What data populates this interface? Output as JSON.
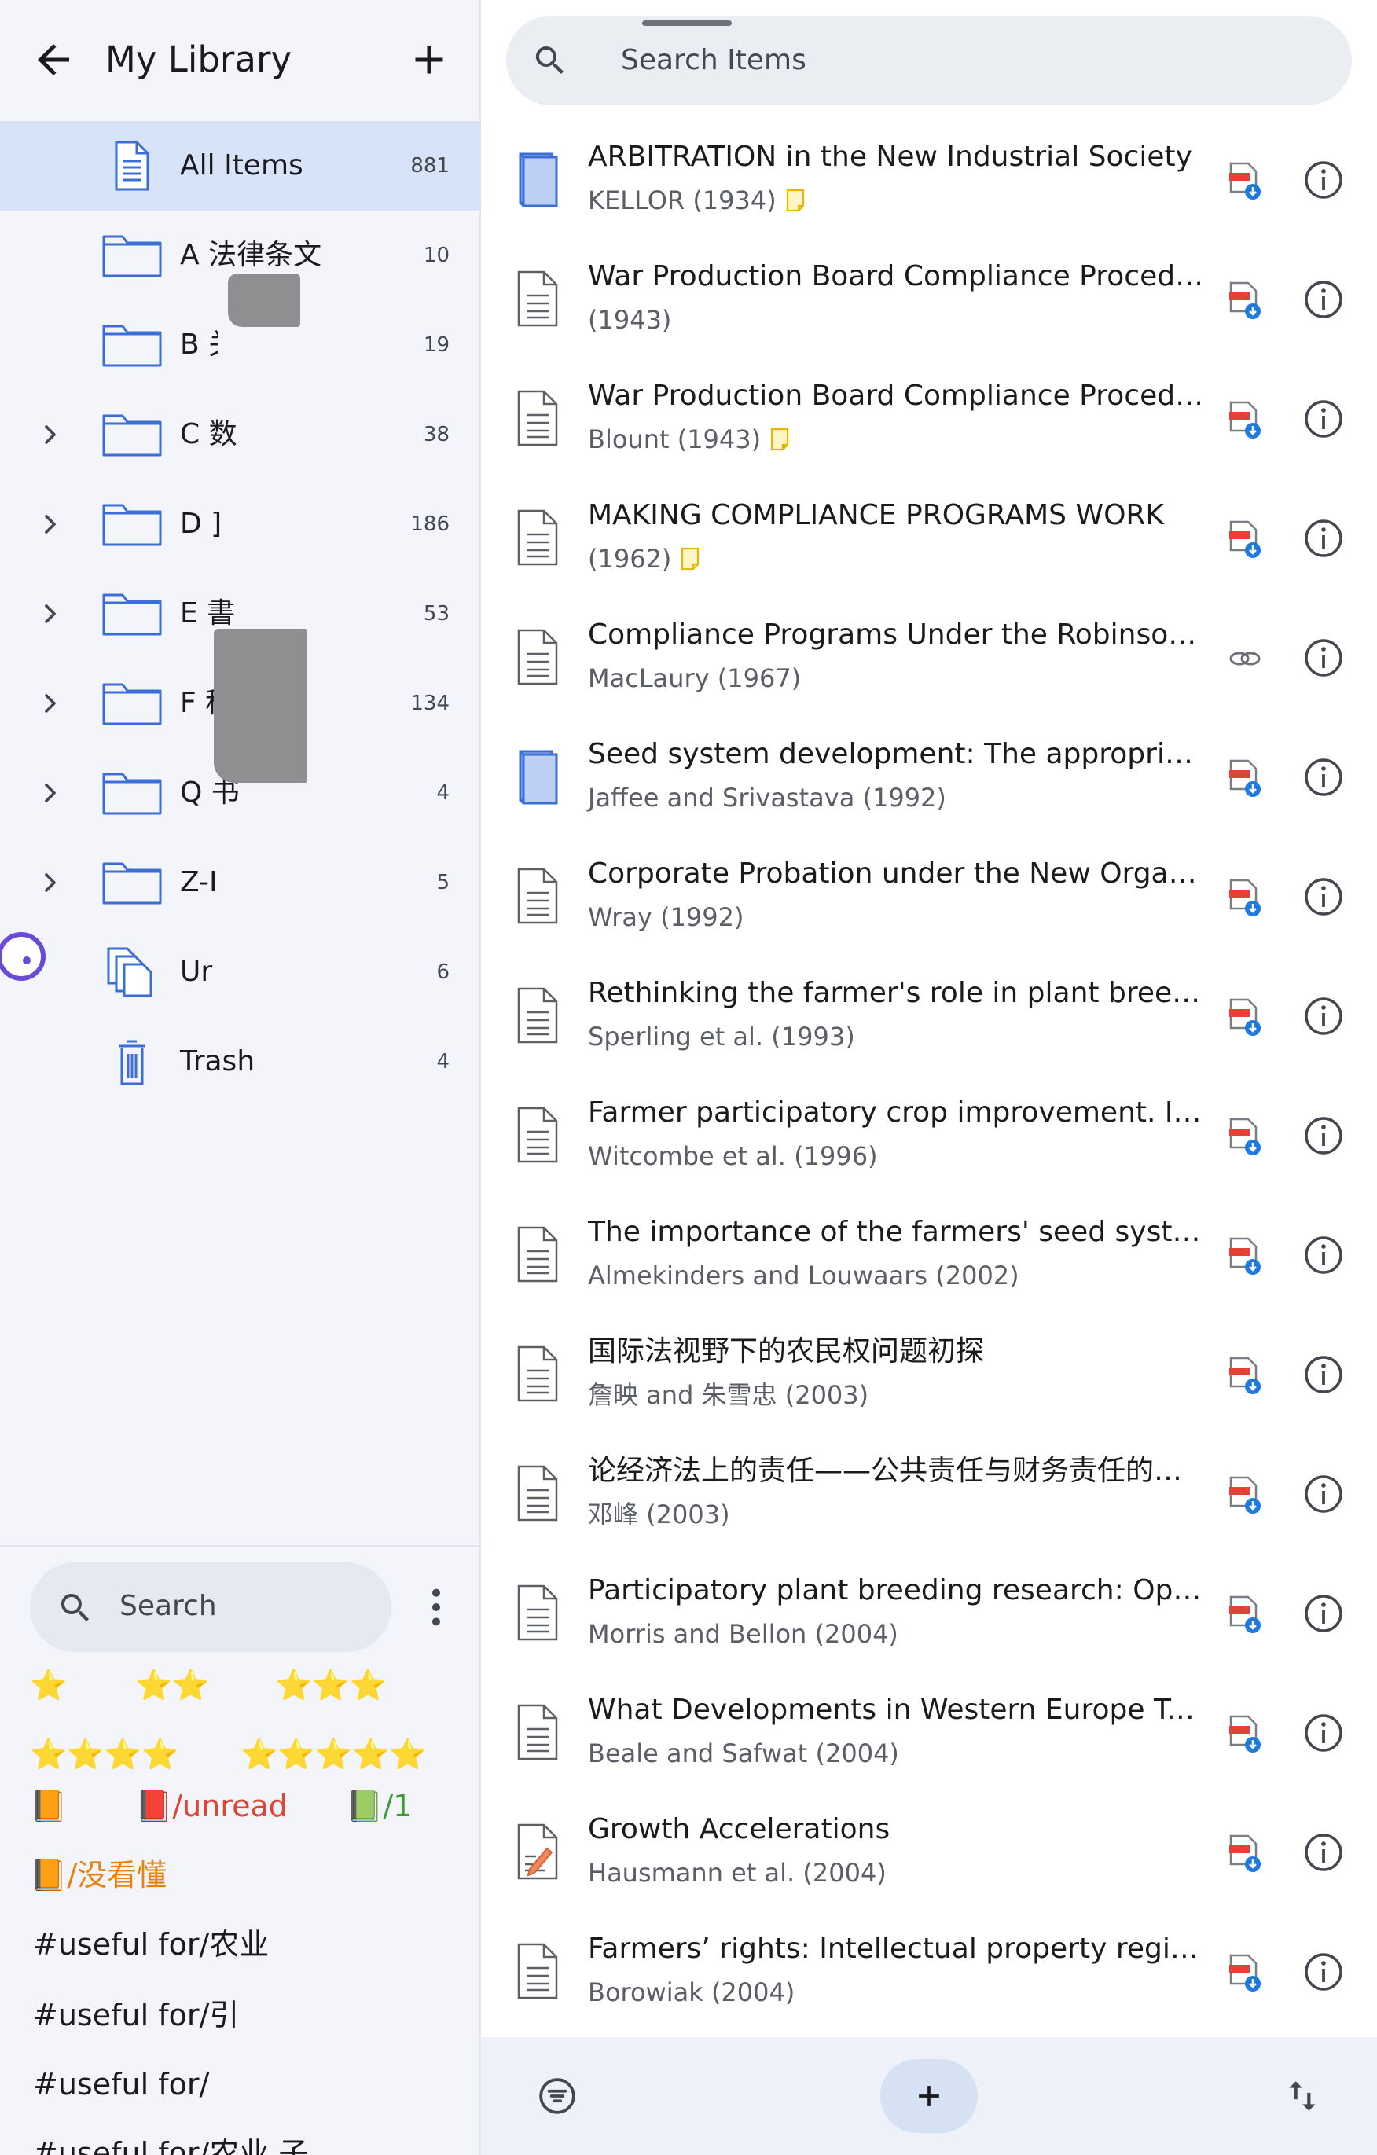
{
  "library": {
    "title": "My Library",
    "collections": [
      {
        "label": "All Items",
        "count": "881",
        "icon": "document-icon",
        "expandable": false,
        "selected": true
      },
      {
        "label": "A 法律条文",
        "count": "10",
        "icon": "folder-icon",
        "expandable": false
      },
      {
        "label": "B 关         ⁻…",
        "count": "19",
        "icon": "folder-icon",
        "expandable": false
      },
      {
        "label": "C 数",
        "count": "38",
        "icon": "folder-icon",
        "expandable": true
      },
      {
        "label": "D    ]",
        "count": "186",
        "icon": "folder-icon",
        "expandable": true
      },
      {
        "label": "E           書",
        "count": "53",
        "icon": "folder-icon",
        "expandable": true
      },
      {
        "label": "F 科",
        "count": "134",
        "icon": "folder-icon",
        "expandable": true
      },
      {
        "label": "Q 书",
        "count": "4",
        "icon": "folder-icon",
        "expandable": true
      },
      {
        "label": "Z-I",
        "count": "5",
        "icon": "folder-icon",
        "expandable": true
      },
      {
        "label": "Ur",
        "count": "6",
        "icon": "unfiled-icon",
        "expandable": false
      },
      {
        "label": "Trash",
        "count": "4",
        "icon": "trash-icon",
        "expandable": false
      }
    ]
  },
  "tags": {
    "search_placeholder": "Search",
    "row1": [
      "⭐",
      "⭐⭐",
      "⭐⭐⭐"
    ],
    "row2": [
      "⭐⭐⭐⭐",
      "⭐⭐⭐⭐⭐"
    ],
    "row3": [
      "📙",
      "📕/unread",
      "📗/1"
    ],
    "row4": [
      "📙/没看懂"
    ],
    "useful": [
      "#useful for/农业",
      "#useful for/引",
      "#useful for/",
      "#useful for/农业    子"
    ]
  },
  "items_search": {
    "placeholder": "Search Items"
  },
  "items": [
    {
      "title": "ARBITRATION in the New Industrial Society",
      "author": "KELLOR (1934)",
      "type": "book",
      "note": true,
      "attachment": "pdf"
    },
    {
      "title": "War Production Board Compliance Procedu…",
      "author": "(1943)",
      "type": "document",
      "note": false,
      "attachment": "pdf"
    },
    {
      "title": "War Production Board Compliance Procedu…",
      "author": "Blount (1943)",
      "type": "document",
      "note": true,
      "attachment": "pdf"
    },
    {
      "title": "MAKING COMPLIANCE PROGRAMS WORK",
      "author": "(1962)",
      "type": "document",
      "note": true,
      "attachment": "pdf"
    },
    {
      "title": "Compliance Programs Under the Robinson-…",
      "author": "MacLaury (1967)",
      "type": "document",
      "note": false,
      "attachment": "link"
    },
    {
      "title": "Seed system development: The appropriate …",
      "author": "Jaffee and Srivastava (1992)",
      "type": "book",
      "note": false,
      "attachment": "pdf"
    },
    {
      "title": "Corporate Probation under the New Organiz…",
      "author": "Wray (1992)",
      "type": "document",
      "note": false,
      "attachment": "pdf"
    },
    {
      "title": "Rethinking the farmer's role in plant breedin…",
      "author": "Sperling et al. (1993)",
      "type": "document",
      "note": false,
      "attachment": "pdf"
    },
    {
      "title": "Farmer participatory crop improvement. I. V…",
      "author": "Witcombe et al. (1996)",
      "type": "document",
      "note": false,
      "attachment": "pdf"
    },
    {
      "title": "The importance of the farmers' seed syste…",
      "author": "Almekinders and Louwaars (2002)",
      "type": "document",
      "note": false,
      "attachment": "pdf"
    },
    {
      "title": "国际法视野下的农民权问题初探",
      "author": "詹映 and 朱雪忠 (2003)",
      "type": "document",
      "note": false,
      "attachment": "pdf"
    },
    {
      "title": "论经济法上的责任——公共责任与财务责任的…",
      "author": "邓峰 (2003)",
      "type": "document",
      "note": false,
      "attachment": "pdf"
    },
    {
      "title": "Participatory plant breeding research: Oppo…",
      "author": "Morris and Bellon (2004)",
      "type": "document",
      "note": false,
      "attachment": "pdf"
    },
    {
      "title": "What Developments in Western Europe Tell …",
      "author": "Beale and Safwat (2004)",
      "type": "document",
      "note": false,
      "attachment": "pdf"
    },
    {
      "title": "Growth Accelerations",
      "author": "Hausmann et al. (2004)",
      "type": "manuscript",
      "note": false,
      "attachment": "pdf"
    },
    {
      "title": "Farmers’ rights: Intellectual property regime…",
      "author": "Borowiak (2004)",
      "type": "document",
      "note": false,
      "attachment": "pdf"
    }
  ],
  "colors": {
    "accent": "#3b6fd6",
    "selected_bg": "#d7e3f8",
    "orange": "#e8820c",
    "red": "#e34234",
    "green": "#3f9c35"
  }
}
